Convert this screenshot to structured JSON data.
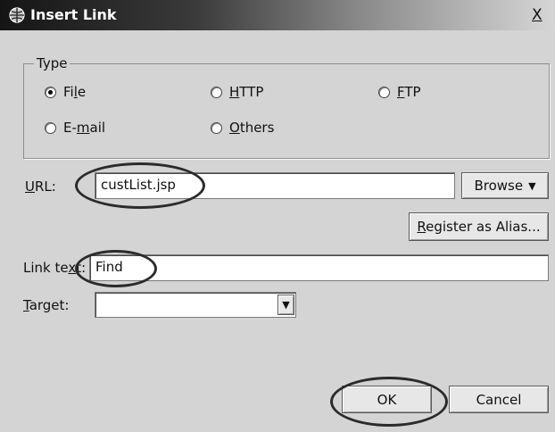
{
  "dialog": {
    "title": "Insert Link",
    "close": "X"
  },
  "type_group": {
    "legend": "Type",
    "options": [
      {
        "pre": "Fi",
        "key": "l",
        "post": "e",
        "checked": true
      },
      {
        "pre": "",
        "key": "H",
        "post": "TTP",
        "checked": false
      },
      {
        "pre": "",
        "key": "F",
        "post": "TP",
        "checked": false
      },
      {
        "pre": "E-",
        "key": "m",
        "post": "ail",
        "checked": false
      },
      {
        "pre": "",
        "key": "O",
        "post": "thers",
        "checked": false
      }
    ]
  },
  "url": {
    "label_key": "U",
    "label_rest": "RL:",
    "value": "custList.jsp",
    "browse": "Browse"
  },
  "alias": {
    "key": "R",
    "rest": "egister as Alias..."
  },
  "link_text": {
    "label_pre": "Link te",
    "label_key": "x",
    "label_post": "t:",
    "value": "Find"
  },
  "target": {
    "label_key": "T",
    "label_rest": "arget:",
    "value": ""
  },
  "buttons": {
    "ok": "OK",
    "cancel": "Cancel"
  }
}
